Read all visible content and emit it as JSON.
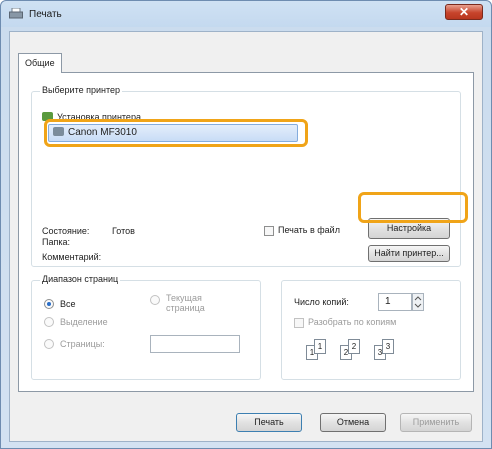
{
  "window": {
    "title": "Печать",
    "close_glyph": "✕"
  },
  "tabs": [
    {
      "label": "Общие"
    }
  ],
  "printer_group": {
    "title": "Выберите принтер",
    "items": [
      {
        "label": "Установка принтера",
        "icon": "add-printer-icon"
      },
      {
        "label": "Canon MF3010",
        "icon": "printer-icon",
        "selected": true
      }
    ]
  },
  "status": {
    "state_label": "Состояние:",
    "state_value": "Готов",
    "folder_label": "Папка:",
    "comment_label": "Комментарий:"
  },
  "print_to_file_label": "Печать в файл",
  "settings_button": "Настройка",
  "find_printer_button": "Найти принтер...",
  "range_group": {
    "title": "Диапазон страниц",
    "all": "Все",
    "selection": "Выделение",
    "current_page": "Текущая страница",
    "pages": "Страницы:"
  },
  "copies": {
    "label": "Число копий:",
    "value": "1",
    "collate_label": "Разобрать по копиям",
    "page_numbers": [
      "1",
      "1",
      "2",
      "2",
      "3",
      "3"
    ]
  },
  "footer": {
    "print": "Печать",
    "cancel": "Отмена",
    "apply": "Применить"
  },
  "colors": {
    "highlight": "#f0a418",
    "selection": "#c8dcf6",
    "close": "#c7442c"
  }
}
